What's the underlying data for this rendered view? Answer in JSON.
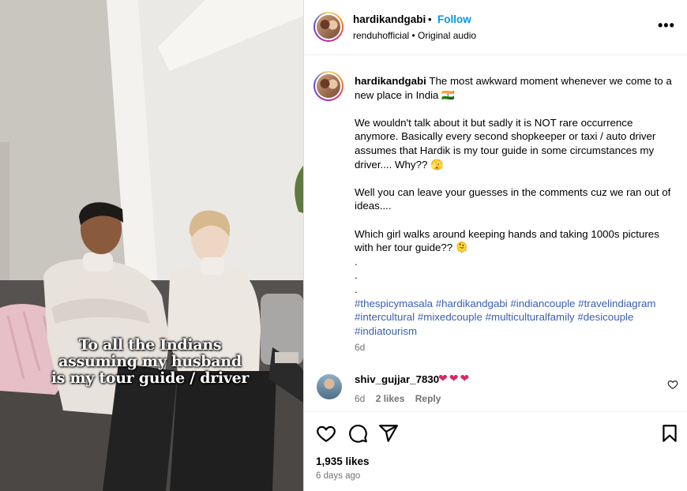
{
  "video": {
    "overlay_lines": [
      "To all the Indians",
      "assuming my husband",
      "is my tour guide / driver"
    ]
  },
  "header": {
    "username": "hardikandgabi",
    "separator": "•",
    "follow_label": "Follow",
    "audio": "renduhofficial • Original audio",
    "more_label": "•••"
  },
  "caption": {
    "username": "hardikandgabi",
    "lines": [
      "The most awkward moment whenever we come to a new place in India 🇮🇳",
      "",
      "We wouldn't talk about it but sadly it is NOT rare occurrence anymore. Basically every second shopkeeper or taxi / auto driver assumes that Hardik is my tour guide in some circumstances my driver.... Why?? 🫣",
      "",
      "Well you can leave your guesses in the comments cuz we ran out of ideas....",
      "",
      "Which girl walks around keeping hands and taking 1000s pictures with her tour guide?? 🫠"
    ],
    "dots": [
      ".",
      ".",
      "."
    ],
    "hashtags": [
      "#thespicymasala",
      "#hardikandgabi",
      "#indiancouple",
      "#travelindiagram",
      "#intercultural",
      "#mixedcouple",
      "#multiculturalfamily",
      "#desicouple",
      "#indiatourism"
    ],
    "time": "6d"
  },
  "comment": {
    "username": "shiv_gujjar_7830",
    "text": "❤❤❤",
    "time": "6d",
    "likes": "2 likes",
    "reply_label": "Reply"
  },
  "actions": {
    "likes": "1,935 likes",
    "ago": "6 days ago"
  },
  "colors": {
    "follow": "#0095f6",
    "hashtag": "#3a5db8",
    "meta": "#737373"
  }
}
